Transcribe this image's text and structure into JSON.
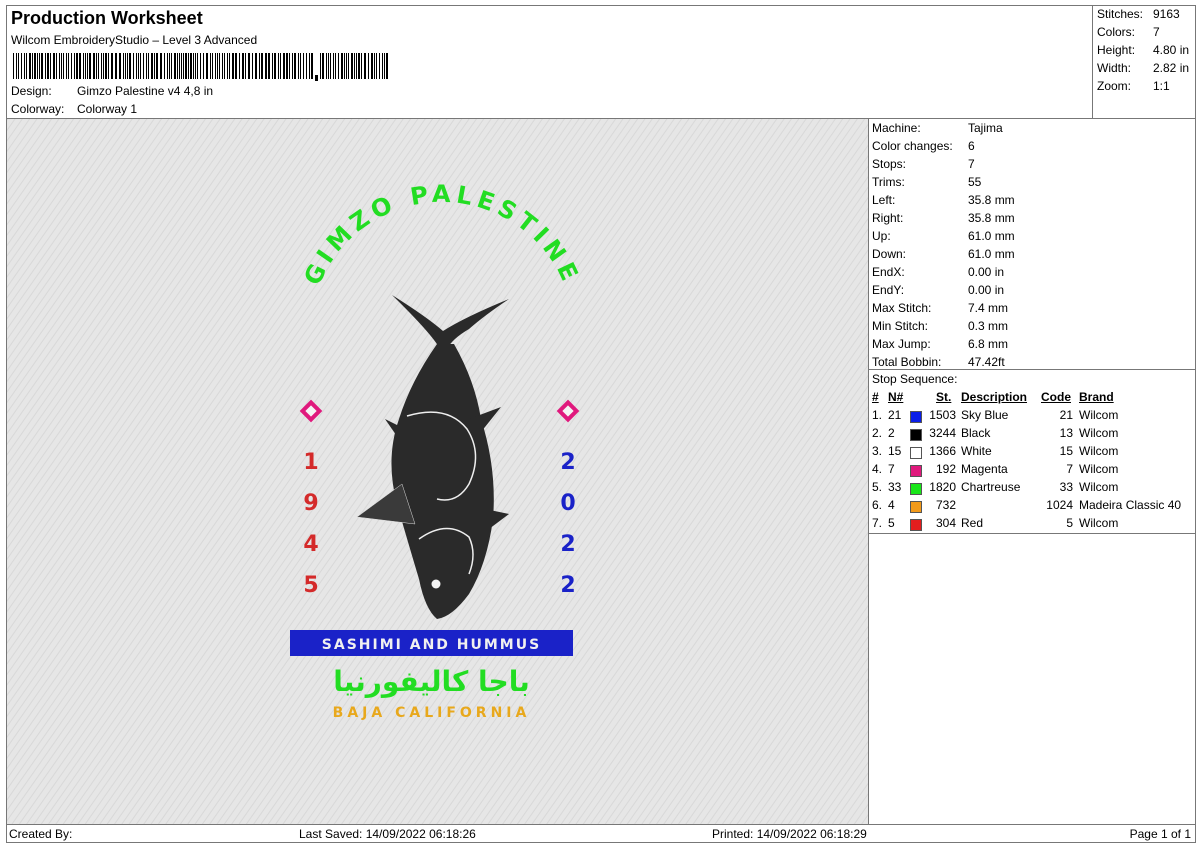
{
  "header": {
    "title": "Production Worksheet",
    "software": "Wilcom EmbroideryStudio – Level 3 Advanced",
    "design_label": "Design:",
    "design_value": "Gimzo Palestine v4 4,8 in",
    "colorway_label": "Colorway:",
    "colorway_value": "Colorway 1"
  },
  "stats": [
    {
      "label": "Stitches:",
      "value": "9163"
    },
    {
      "label": "Colors:",
      "value": "7"
    },
    {
      "label": "Height:",
      "value": "4.80 in"
    },
    {
      "label": "Width:",
      "value": "2.82 in"
    },
    {
      "label": "Zoom:",
      "value": "1:1"
    }
  ],
  "details": [
    {
      "label": "Machine:",
      "value": "Tajima"
    },
    {
      "label": "Color changes:",
      "value": "6"
    },
    {
      "label": "Stops:",
      "value": "7"
    },
    {
      "label": "Trims:",
      "value": "55"
    },
    {
      "label": "Left:",
      "value": "35.8 mm"
    },
    {
      "label": "Right:",
      "value": "35.8 mm"
    },
    {
      "label": "Up:",
      "value": "61.0 mm"
    },
    {
      "label": "Down:",
      "value": "61.0 mm"
    },
    {
      "label": "EndX:",
      "value": "0.00 in"
    },
    {
      "label": "EndY:",
      "value": "0.00 in"
    },
    {
      "label": "Max Stitch:",
      "value": "7.4 mm"
    },
    {
      "label": "Min Stitch:",
      "value": "0.3 mm"
    },
    {
      "label": "Max Jump:",
      "value": "6.8 mm"
    },
    {
      "label": "Total Bobbin:",
      "value": "47.42ft"
    }
  ],
  "stop_sequence": {
    "title": "Stop Sequence:",
    "columns": [
      "#",
      "N#",
      "St.",
      "Description",
      "Code",
      "Brand"
    ],
    "rows": [
      {
        "idx": "1.",
        "n": "21",
        "color": "#0a1ee8",
        "st": "1503",
        "desc": "Sky Blue",
        "code": "21",
        "brand": "Wilcom"
      },
      {
        "idx": "2.",
        "n": "2",
        "color": "#000000",
        "st": "3244",
        "desc": "Black",
        "code": "13",
        "brand": "Wilcom"
      },
      {
        "idx": "3.",
        "n": "15",
        "color": "#ffffff",
        "st": "1366",
        "desc": "White",
        "code": "15",
        "brand": "Wilcom"
      },
      {
        "idx": "4.",
        "n": "7",
        "color": "#e0197d",
        "st": "192",
        "desc": "Magenta",
        "code": "7",
        "brand": "Wilcom"
      },
      {
        "idx": "5.",
        "n": "33",
        "color": "#19e619",
        "st": "1820",
        "desc": "Chartreuse",
        "code": "33",
        "brand": "Wilcom"
      },
      {
        "idx": "6.",
        "n": "4",
        "color": "#f29a1a",
        "st": "732",
        "desc": "",
        "code": "1024",
        "brand": "Madeira Classic 40"
      },
      {
        "idx": "7.",
        "n": "5",
        "color": "#e31e1e",
        "st": "304",
        "desc": "Red",
        "code": "5",
        "brand": "Wilcom"
      }
    ]
  },
  "design": {
    "arc_text": "GIMZO PALESTINE",
    "left_year": [
      "1",
      "9",
      "4",
      "5"
    ],
    "right_year": [
      "2",
      "0",
      "2",
      "2"
    ],
    "banner": "SASHIMI AND HUMMUS",
    "arabic": "باجا كاليفورنيا",
    "bottom": "BAJA CALIFORNIA",
    "colors": {
      "green": "#22dd22",
      "red": "#d42a2a",
      "blue": "#1a22c8",
      "magenta": "#e0197d",
      "gold": "#e8a81c",
      "fish": "#2a2a2a"
    }
  },
  "footer": {
    "created": "Created By:",
    "saved": "Last Saved: 14/09/2022 06:18:26",
    "printed": "Printed: 14/09/2022 06:18:29",
    "page": "Page 1 of 1"
  }
}
